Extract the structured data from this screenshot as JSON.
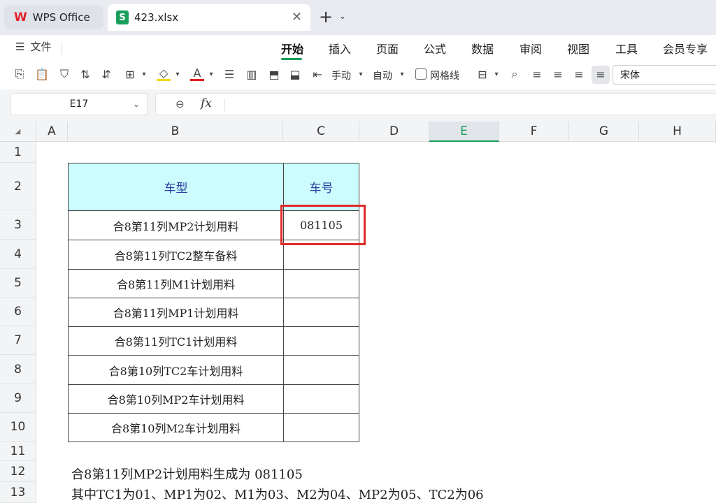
{
  "tabs": {
    "home_label": "WPS Office",
    "file_label": "423.xlsx",
    "file_icon": "S"
  },
  "menu": {
    "file_label": "文件",
    "items": [
      "开始",
      "插入",
      "页面",
      "公式",
      "数据",
      "审阅",
      "视图",
      "工具",
      "会员专享"
    ],
    "active": "开始"
  },
  "toolbar": {
    "manual_label": "手动",
    "auto_label": "自动",
    "gridlines_label": "网格线",
    "font_name": "宋体"
  },
  "formula_bar": {
    "cell_ref": "E17",
    "fx": "fx",
    "value": ""
  },
  "sheet": {
    "columns": [
      "A",
      "B",
      "C",
      "D",
      "E",
      "F",
      "G",
      "H"
    ],
    "selected_column": "E",
    "rows": [
      "1",
      "2",
      "3",
      "4",
      "5",
      "6",
      "7",
      "8",
      "9",
      "10",
      "11",
      "12",
      "13"
    ],
    "table_header": {
      "b": "车型",
      "c": "车号"
    },
    "table_rows": [
      {
        "b": "合8第11列MP2计划用料",
        "c": "081105"
      },
      {
        "b": "合8第11列TC2整车备料",
        "c": ""
      },
      {
        "b": "合8第11列M1计划用料",
        "c": ""
      },
      {
        "b": "合8第11列MP1计划用料",
        "c": ""
      },
      {
        "b": "合8第11列TC1计划用料",
        "c": ""
      },
      {
        "b": "合8第10列TC2车计划用料",
        "c": ""
      },
      {
        "b": "合8第10列MP2车计划用料",
        "c": ""
      },
      {
        "b": "合8第10列M2车计划用料",
        "c": ""
      }
    ],
    "note_line1": "合8第11列MP2计划用料生成为 081105",
    "note_line2": "其中TC1为01、MP1为02、M1为03、M2为04、MP2为05、TC2为06"
  },
  "colors": {
    "accent": "#1a9e5c",
    "header_fill": "#ccfcfd",
    "header_text": "#2a3f9e",
    "highlight": "#e12a2a"
  }
}
